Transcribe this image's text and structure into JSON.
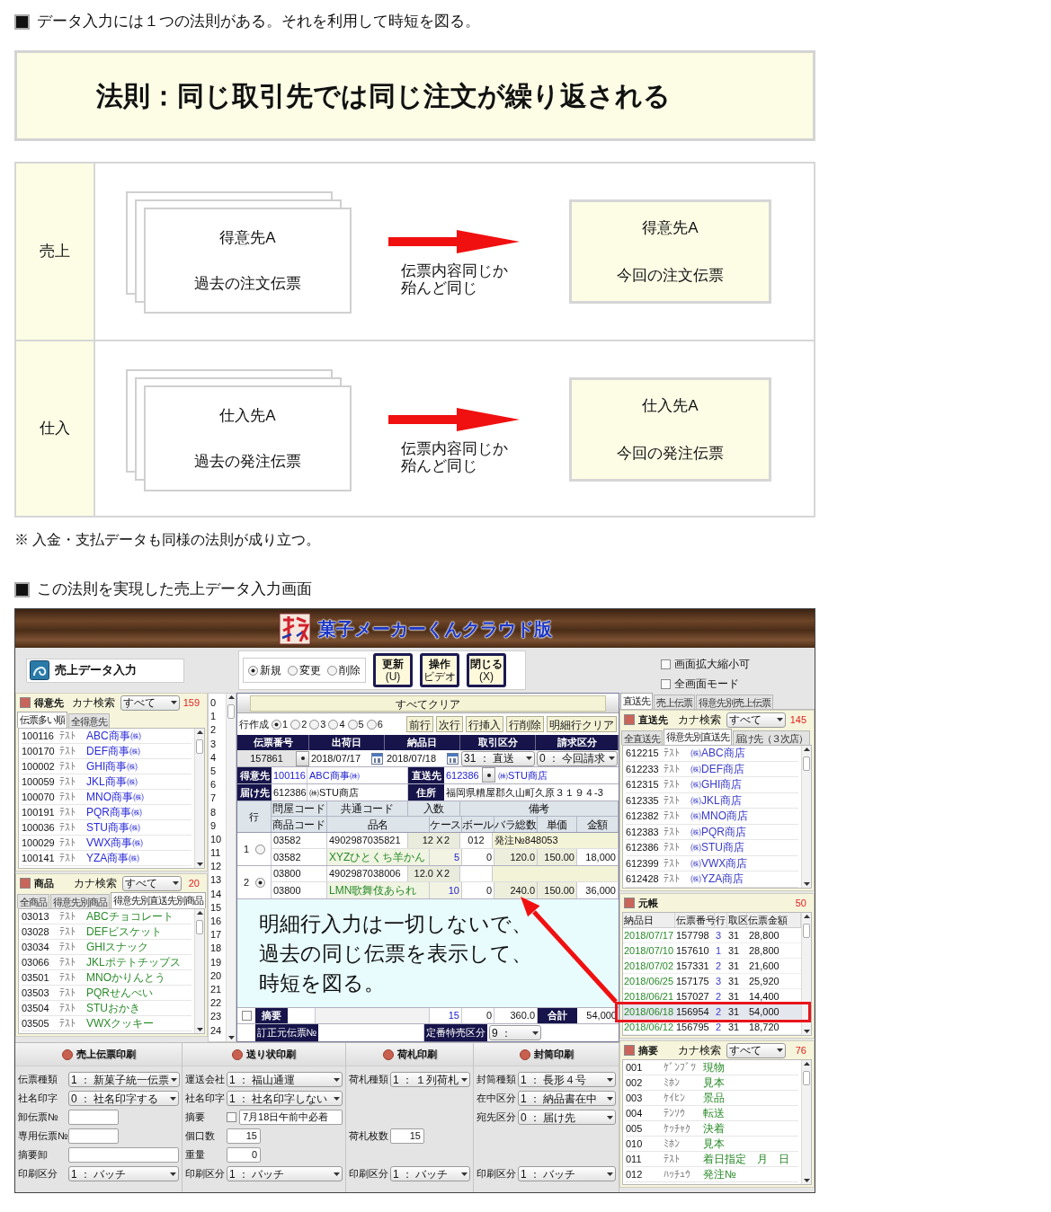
{
  "intro": {
    "heading": "データ入力には１つの法則がある。それを利用して時短を図る。"
  },
  "rule_banner": {
    "text": "法則：同じ取引先では同じ注文が繰り返される"
  },
  "rule_table": {
    "rows": [
      {
        "label": "売上",
        "past_card": {
          "title": "得意先A",
          "subtitle": "過去の注文伝票"
        },
        "arrow_caption": [
          "伝票内容同じか",
          "殆んど同じ"
        ],
        "current_card": {
          "title": "得意先A",
          "subtitle": "今回の注文伝票"
        }
      },
      {
        "label": "仕入",
        "past_card": {
          "title": "仕入先A",
          "subtitle": "過去の発注伝票"
        },
        "arrow_caption": [
          "伝票内容同じか",
          "殆んど同じ"
        ],
        "current_card": {
          "title": "仕入先A",
          "subtitle": "今回の発注伝票"
        }
      }
    ]
  },
  "note": "※ 入金・支払データも同様の法則が成り立つ。",
  "screen_heading": "この法則を実現した売上データ入力画面",
  "app": {
    "title": "菓子メーカーくんクラウド版",
    "screen_title": "売上データ入力",
    "mode_options": [
      {
        "label": "新規",
        "selected": true
      },
      {
        "label": "変更",
        "selected": false
      },
      {
        "label": "削除",
        "selected": false
      }
    ],
    "toolbar_buttons": [
      {
        "lines": [
          "更新",
          "(U)"
        ]
      },
      {
        "lines": [
          "操作",
          "ビデオ"
        ]
      },
      {
        "lines": [
          "閉じる",
          "(X)"
        ]
      }
    ],
    "view_options": [
      {
        "label": "画面拡大縮小可",
        "checked": false
      },
      {
        "label": "全画面モード",
        "checked": false
      }
    ],
    "customer_panel": {
      "title": "得意先",
      "search_label": "カナ検索",
      "search_value": "すべて",
      "count": "159",
      "tabs": [
        {
          "label": "伝票多い順",
          "selected": true
        },
        {
          "label": "全得意先",
          "selected": false
        }
      ],
      "rows": [
        {
          "code": "100116",
          "kana": "ﾃｽﾄ",
          "name": "ABC商事㈱"
        },
        {
          "code": "100170",
          "kana": "ﾃｽﾄ",
          "name": "DEF商事㈱"
        },
        {
          "code": "100002",
          "kana": "ﾃｽﾄ",
          "name": "GHI商事㈱"
        },
        {
          "code": "100059",
          "kana": "ﾃｽﾄ",
          "name": "JKL商事㈱"
        },
        {
          "code": "100070",
          "kana": "ﾃｽﾄ",
          "name": "MNO商事㈱"
        },
        {
          "code": "100191",
          "kana": "ﾃｽﾄ",
          "name": "PQR商事㈱"
        },
        {
          "code": "100036",
          "kana": "ﾃｽﾄ",
          "name": "STU商事㈱"
        },
        {
          "code": "100029",
          "kana": "ﾃｽﾄ",
          "name": "VWX商事㈱"
        },
        {
          "code": "100141",
          "kana": "ﾃｽﾄ",
          "name": "YZA商事㈱"
        }
      ]
    },
    "product_panel": {
      "title": "商品",
      "search_label": "カナ検索",
      "search_value": "すべて",
      "count": "20",
      "tabs": [
        {
          "label": "全商品",
          "selected": false
        },
        {
          "label": "得意先別商品",
          "selected": false
        },
        {
          "label": "得意先別直送先別商品",
          "selected": true
        }
      ],
      "rows": [
        {
          "code": "03013",
          "kana": "ﾃｽﾄ",
          "name": "ABCチョコレート"
        },
        {
          "code": "03028",
          "kana": "ﾃｽﾄ",
          "name": "DEFビスケット"
        },
        {
          "code": "03034",
          "kana": "ﾃｽﾄ",
          "name": "GHIスナック"
        },
        {
          "code": "03066",
          "kana": "ﾃｽﾄ",
          "name": "JKLポテトチップス"
        },
        {
          "code": "03501",
          "kana": "ﾃｽﾄ",
          "name": "MNOかりんとう"
        },
        {
          "code": "03503",
          "kana": "ﾃｽﾄ",
          "name": "PQRせんべい"
        },
        {
          "code": "03504",
          "kana": "ﾃｽﾄ",
          "name": "STUおかき"
        },
        {
          "code": "03505",
          "kana": "ﾃｽﾄ",
          "name": "VWXクッキー"
        }
      ]
    },
    "line_numbers": [
      "0",
      "1",
      "2",
      "3",
      "4",
      "5",
      "6",
      "7",
      "8",
      "9",
      "10",
      "11",
      "12",
      "13",
      "14",
      "15",
      "16",
      "17",
      "18",
      "19",
      "20",
      "21",
      "22",
      "23",
      "24"
    ],
    "entry": {
      "clear_button": "すべてクリア",
      "row_mode_label": "行作成",
      "row_modes": [
        {
          "label": "1",
          "selected": true
        },
        {
          "label": "2",
          "selected": false
        },
        {
          "label": "3",
          "selected": false
        },
        {
          "label": "4",
          "selected": false
        },
        {
          "label": "5",
          "selected": false
        },
        {
          "label": "6",
          "selected": false
        }
      ],
      "row_buttons": [
        "前行",
        "次行",
        "行挿入",
        "行削除",
        "明細行クリア"
      ],
      "header_columns": [
        "伝票番号",
        "出荷日",
        "納品日",
        "取引区分",
        "請求区分"
      ],
      "slip_no": "157861",
      "ship_date": "2018/07/17",
      "delivery_date": "2018/07/18",
      "trade_type": "31 ： 直送",
      "billing_type": "0 ： 今回請求",
      "customer": {
        "label": "得意先",
        "code": "100116",
        "name": "ABC商事㈱"
      },
      "direct": {
        "label": "直送先",
        "code": "612386",
        "name": "㈱STU商店"
      },
      "deliver_to": {
        "label": "届け先",
        "code": "612386",
        "name": "㈱STU商店"
      },
      "address": {
        "label": "住所",
        "value": "福岡県糟屋郡久山町久原３１９４-3"
      },
      "row_header": "行",
      "header_top": [
        "問屋コード",
        "共通コード",
        "入数",
        "備考"
      ],
      "header_bottom": [
        "商品コード",
        "品名",
        "ケース",
        "ボール",
        "バラ総数",
        "単価",
        "金額"
      ],
      "lines": [
        {
          "no": "1",
          "selected": false,
          "wholesale_code": "03582",
          "jan": "4902987035821",
          "pack": "12",
          "mult": "X",
          "pack_qty": "2",
          "ball_code": "012",
          "remark": "発注№848053",
          "product_code": "03582",
          "product_name": "XYZひとくち羊かん",
          "cases": "5",
          "balls": "0",
          "pieces": "120.0",
          "unit_price": "150.00",
          "amount": "18,000"
        },
        {
          "no": "2",
          "selected": true,
          "wholesale_code": "03800",
          "jan": "4902987038006",
          "pack": "12.0",
          "mult": "X",
          "pack_qty": "2",
          "product_code": "03800",
          "product_name": "LMN歌舞伎あられ",
          "cases": "10",
          "balls": "0",
          "pieces": "240.0",
          "unit_price": "150.00",
          "amount": "36,000"
        }
      ],
      "annotation": [
        "明細行入力は一切しないで、",
        "過去の同じ伝票を表示して、",
        "時短を図る。"
      ],
      "summary": {
        "checked": false,
        "label": "摘要",
        "cases": "15",
        "balls": "0",
        "pieces": "360.0",
        "total_label": "合計",
        "total": "54,000"
      },
      "correction_label": "訂正元伝票№",
      "special_label": "定番特売区分",
      "special_value": "9 ："
    },
    "side_tabs": [
      {
        "label": "直送先",
        "selected": true
      },
      {
        "label": "売上伝票",
        "selected": false
      },
      {
        "label": "得意先別売上伝票",
        "selected": false
      }
    ],
    "direct_panel": {
      "title": "直送先",
      "search_label": "カナ検索",
      "search_value": "すべて",
      "count": "145",
      "tabs": [
        {
          "label": "全直送先",
          "selected": false
        },
        {
          "label": "得意先別直送先",
          "selected": true
        },
        {
          "label": "届け先（３次店）",
          "selected": false
        }
      ],
      "rows": [
        {
          "code": "612215",
          "kana": "ﾃｽﾄ",
          "name": "㈱ABC商店"
        },
        {
          "code": "612233",
          "kana": "ﾃｽﾄ",
          "name": "㈱DEF商店"
        },
        {
          "code": "612315",
          "kana": "ﾃｽﾄ",
          "name": "㈱GHI商店"
        },
        {
          "code": "612335",
          "kana": "ﾃｽﾄ",
          "name": "㈱JKL商店"
        },
        {
          "code": "612382",
          "kana": "ﾃｽﾄ",
          "name": "㈱MNO商店"
        },
        {
          "code": "612383",
          "kana": "ﾃｽﾄ",
          "name": "㈱PQR商店"
        },
        {
          "code": "612386",
          "kana": "ﾃｽﾄ",
          "name": "㈱STU商店"
        },
        {
          "code": "612399",
          "kana": "ﾃｽﾄ",
          "name": "㈱VWX商店"
        },
        {
          "code": "612428",
          "kana": "ﾃｽﾄ",
          "name": "㈱YZA商店"
        }
      ]
    },
    "ledger": {
      "title": "元帳",
      "count": "50",
      "columns": [
        "納品日",
        "伝票番号",
        "行",
        "取区",
        "伝票金額"
      ],
      "rows": [
        {
          "date": "2018/07/17",
          "slip": "157798",
          "line": "3",
          "trade": "31",
          "amount": "28,800",
          "selected": false
        },
        {
          "date": "2018/07/10",
          "slip": "157610",
          "line": "1",
          "trade": "31",
          "amount": "28,800",
          "selected": false
        },
        {
          "date": "2018/07/02",
          "slip": "157331",
          "line": "2",
          "trade": "31",
          "amount": "21,600",
          "selected": false
        },
        {
          "date": "2018/06/25",
          "slip": "157175",
          "line": "3",
          "trade": "31",
          "amount": "25,920",
          "selected": false
        },
        {
          "date": "2018/06/21",
          "slip": "157027",
          "line": "2",
          "trade": "31",
          "amount": "14,400",
          "selected": false
        },
        {
          "date": "2018/06/18",
          "slip": "156954",
          "line": "2",
          "trade": "31",
          "amount": "54,000",
          "selected": true
        },
        {
          "date": "2018/06/12",
          "slip": "156795",
          "line": "2",
          "trade": "31",
          "amount": "18,720",
          "selected": false
        }
      ]
    },
    "memo_panel": {
      "title": "摘要",
      "search_label": "カナ検索",
      "search_value": "すべて",
      "count": "76",
      "rows": [
        {
          "code": "001",
          "kana": "ｹﾞﾝﾌﾞﾂ",
          "name": "現物"
        },
        {
          "code": "002",
          "kana": "ﾐﾎﾝ",
          "name": "見本"
        },
        {
          "code": "003",
          "kana": "ｹｲﾋﾝ",
          "name": "景品"
        },
        {
          "code": "004",
          "kana": "ﾃﾝｿｳ",
          "name": "転送"
        },
        {
          "code": "005",
          "kana": "ｹｯﾁｬｸ",
          "name": "決着"
        },
        {
          "code": "010",
          "kana": "ﾐﾎﾝ",
          "name": "見本"
        },
        {
          "code": "011",
          "kana": "ﾃｽﾄ",
          "name": "着日指定　月　日"
        },
        {
          "code": "012",
          "kana": "ﾊｯﾁｭｳ",
          "name": "発注№"
        }
      ]
    },
    "print_panels": [
      {
        "title": "売上伝票印刷",
        "fields": [
          {
            "kind": "select",
            "label": "伝票種類",
            "value": "1 ： 新菓子統一伝票"
          },
          {
            "kind": "select",
            "label": "社名印字",
            "value": "0 ： 社名印字する"
          },
          {
            "kind": "input",
            "label": "卸伝票№"
          },
          {
            "kind": "readonly",
            "label": "専用伝票№"
          },
          {
            "kind": "readonly_wide",
            "label": "摘要卸"
          },
          {
            "kind": "select",
            "label": "印刷区分",
            "value": "1 ： バッチ"
          }
        ]
      },
      {
        "title": "送り状印刷",
        "fields": [
          {
            "kind": "select",
            "label": "運送会社",
            "value": "1 ： 福山通運"
          },
          {
            "kind": "select",
            "label": "社名印字",
            "value": "1 ： 社名印字しない"
          },
          {
            "kind": "check_input",
            "label": "摘要",
            "checked": false,
            "value": "7月18日午前中必着"
          },
          {
            "kind": "number",
            "label": "個口数",
            "value": "15"
          },
          {
            "kind": "number",
            "label": "重量",
            "value": "0"
          },
          {
            "kind": "select",
            "label": "印刷区分",
            "value": "1 ： バッチ"
          }
        ]
      },
      {
        "title": "荷札印刷",
        "fields": [
          {
            "kind": "select",
            "label": "荷札種類",
            "value": "1 ： １列荷札"
          },
          {
            "kind": "spacer"
          },
          {
            "kind": "spacer"
          },
          {
            "kind": "number",
            "label": "荷札枚数",
            "value": "15"
          },
          {
            "kind": "spacer"
          },
          {
            "kind": "select",
            "label": "印刷区分",
            "value": "1 ： バッチ"
          }
        ]
      },
      {
        "title": "封筒印刷",
        "fields": [
          {
            "kind": "select",
            "label": "封筒種類",
            "value": "1 ： 長形４号"
          },
          {
            "kind": "select",
            "label": "在中区分",
            "value": "1 ： 納品書在中"
          },
          {
            "kind": "select",
            "label": "宛先区分",
            "value": "0 ： 届け先"
          },
          {
            "kind": "spacer"
          },
          {
            "kind": "spacer"
          },
          {
            "kind": "select",
            "label": "印刷区分",
            "value": "1 ： バッチ"
          }
        ]
      }
    ]
  }
}
